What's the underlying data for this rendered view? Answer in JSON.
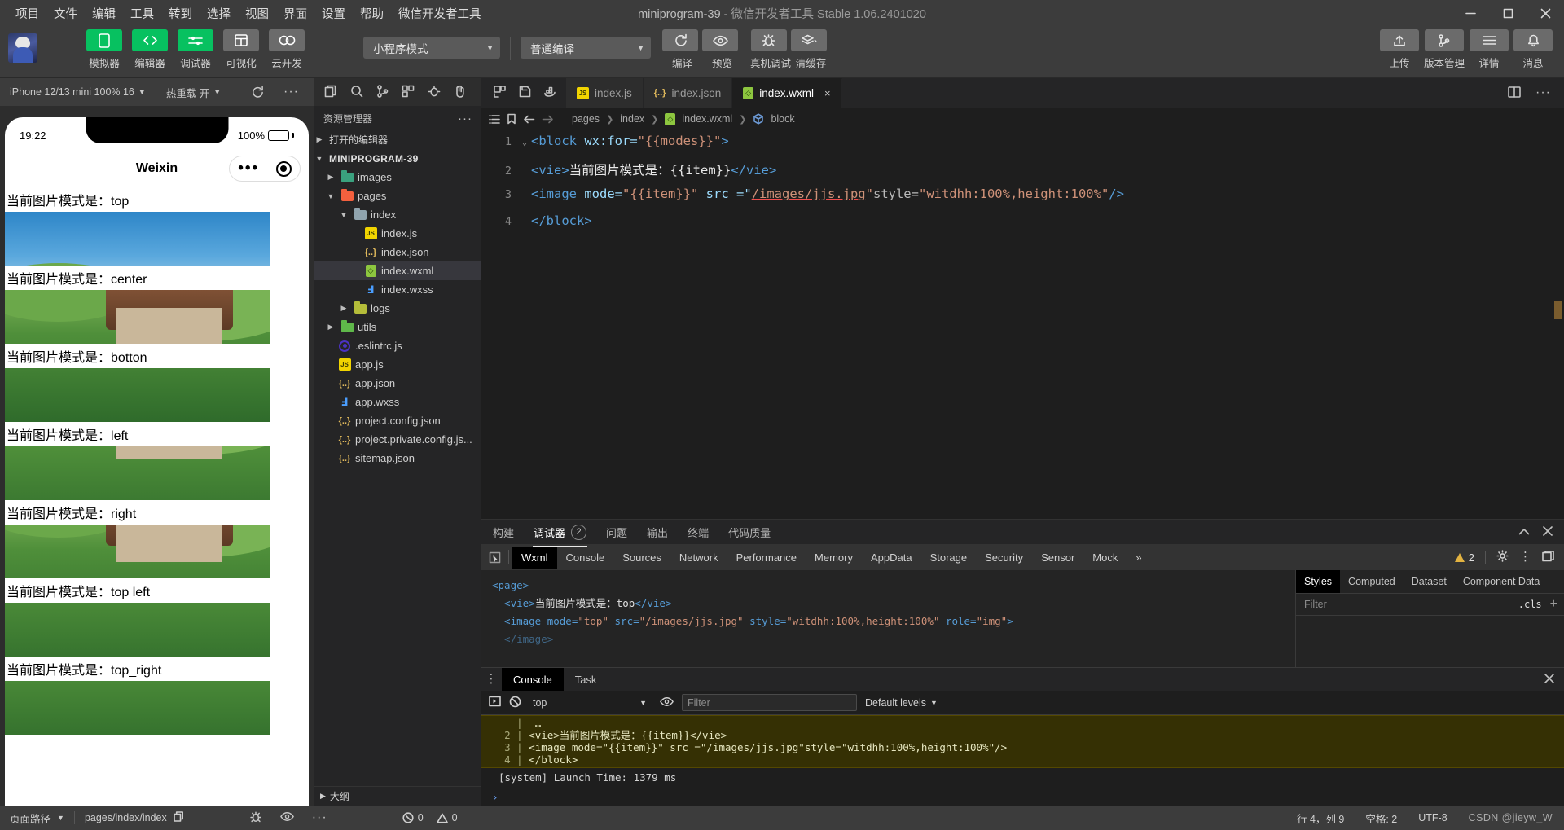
{
  "menubar": {
    "items": [
      "项目",
      "文件",
      "编辑",
      "工具",
      "转到",
      "选择",
      "视图",
      "界面",
      "设置",
      "帮助",
      "微信开发者工具"
    ],
    "title_main": "miniprogram-39",
    "title_dim": "- 微信开发者工具 Stable 1.06.2401020",
    "window_controls": [
      "minimize-icon",
      "maximize-icon",
      "close-icon"
    ]
  },
  "toolbar": {
    "modes": [
      {
        "label": "模拟器",
        "icon": "phone-icon",
        "active": true
      },
      {
        "label": "编辑器",
        "icon": "code-icon",
        "active": true
      },
      {
        "label": "调试器",
        "icon": "sliders-icon",
        "active": true
      },
      {
        "label": "可视化",
        "icon": "layout-icon",
        "active": false
      },
      {
        "label": "云开发",
        "icon": "cloud-icon",
        "active": false
      }
    ],
    "mode_select": "小程序模式",
    "compile_select": "普通编译",
    "actions": [
      {
        "label": "编译",
        "icon": "refresh-icon"
      },
      {
        "label": "预览",
        "icon": "eye-icon"
      },
      {
        "label": "真机调试",
        "icon": "bug-icon"
      },
      {
        "label": "清缓存",
        "icon": "layers-icon"
      }
    ],
    "right_actions": [
      {
        "label": "上传",
        "icon": "upload-icon"
      },
      {
        "label": "版本管理",
        "icon": "branch-icon"
      },
      {
        "label": "详情",
        "icon": "menu-icon"
      },
      {
        "label": "消息",
        "icon": "bell-icon"
      }
    ]
  },
  "simulator": {
    "device": "iPhone 12/13 mini 100% 16",
    "hot_reload": "热重载 开",
    "refresh_icon": "refresh-icon",
    "more_icon": "ellipsis-icon",
    "status_time": "19:22",
    "battery_pct": "100%",
    "nav_title": "Weixin",
    "items": [
      {
        "label": "当前图片模式是：",
        "value": "top"
      },
      {
        "label": "当前图片模式是：",
        "value": "center"
      },
      {
        "label": "当前图片模式是：",
        "value": "botton"
      },
      {
        "label": "当前图片模式是：",
        "value": "left"
      },
      {
        "label": "当前图片模式是：",
        "value": "right"
      },
      {
        "label": "当前图片模式是：",
        "value": "top left"
      },
      {
        "label": "当前图片模式是：",
        "value": "top_right"
      }
    ]
  },
  "explorer": {
    "icons": [
      "new-file-icon",
      "search-icon",
      "source-control-icon",
      "extensions-icon",
      "debug-icon",
      "hand-icon"
    ],
    "title": "资源管理器",
    "more_icon": "ellipsis-icon",
    "open_editors": "打开的编辑器",
    "project_root": "MINIPROGRAM-39",
    "tree": [
      {
        "label": "images",
        "type": "folder",
        "depth": 1,
        "expanded": false
      },
      {
        "label": "pages",
        "type": "folder-red",
        "depth": 1,
        "expanded": true
      },
      {
        "label": "index",
        "type": "folder-plain",
        "depth": 2,
        "expanded": true
      },
      {
        "label": "index.js",
        "type": "js",
        "depth": 3
      },
      {
        "label": "index.json",
        "type": "json",
        "depth": 3
      },
      {
        "label": "index.wxml",
        "type": "wxml",
        "depth": 3,
        "selected": true
      },
      {
        "label": "index.wxss",
        "type": "wxss",
        "depth": 3
      },
      {
        "label": "logs",
        "type": "folder-olive",
        "depth": 1,
        "expanded": false
      },
      {
        "label": "utils",
        "type": "folder-green",
        "depth": 1,
        "expanded": false
      },
      {
        "label": ".eslintrc.js",
        "type": "eslint",
        "depth": 1
      },
      {
        "label": "app.js",
        "type": "js",
        "depth": 1
      },
      {
        "label": "app.json",
        "type": "json",
        "depth": 1
      },
      {
        "label": "app.wxss",
        "type": "wxss",
        "depth": 1
      },
      {
        "label": "project.config.json",
        "type": "json",
        "depth": 1
      },
      {
        "label": "project.private.config.js...",
        "type": "json",
        "depth": 1
      },
      {
        "label": "sitemap.json",
        "type": "json",
        "depth": 1
      }
    ],
    "outline": "大纲"
  },
  "editor": {
    "tab_actions": [
      "split-icon",
      "save-icon",
      "docker-icon"
    ],
    "tabs": [
      {
        "label": "index.js",
        "icon": "js",
        "active": false
      },
      {
        "label": "index.json",
        "icon": "json",
        "active": false
      },
      {
        "label": "index.wxml",
        "icon": "wxml",
        "active": true,
        "close": "×"
      }
    ],
    "tabs_right": [
      "split-editor-icon",
      "ellipsis-icon"
    ],
    "breadcrumb_icons": [
      "outline-icon",
      "bookmark-icon",
      "back-icon",
      "forward-icon"
    ],
    "breadcrumb": [
      "pages",
      "index",
      "index.wxml",
      "block"
    ],
    "lines": [
      {
        "n": "1",
        "fold": "⌄"
      },
      {
        "n": "2",
        "fold": ""
      },
      {
        "n": "3",
        "fold": ""
      },
      {
        "n": "4",
        "fold": ""
      }
    ],
    "code": {
      "l1_a": "<block",
      "l1_b": " wx:for=",
      "l1_c": "\"{{modes}}\"",
      "l1_d": ">",
      "l2_a": "<vie>",
      "l2_b": "当前图片模式是：{{item}}",
      "l2_c": "</vie>",
      "l3_a": "<image",
      "l3_b": " mode=",
      "l3_c": "\"{{item}}\"",
      "l3_d": " src =\"",
      "l3_e": "/images/jjs.jpg",
      "l3_f": "\"",
      "l3_g": "style=",
      "l3_h": "\"witdhh:100%,height:100%\"",
      "l3_i": "/>",
      "l4_a": "</block>"
    }
  },
  "debugger": {
    "tabs": [
      {
        "label": "构建",
        "active": false
      },
      {
        "label": "调试器",
        "active": true,
        "count": "2"
      },
      {
        "label": "问题",
        "active": false
      },
      {
        "label": "输出",
        "active": false
      },
      {
        "label": "终端",
        "active": false
      },
      {
        "label": "代码质量",
        "active": false
      }
    ],
    "collapse_icon": "chevron-up-icon",
    "close_icon": "close-icon",
    "devtools_tabs": [
      "Wxml",
      "Console",
      "Sources",
      "Network",
      "Performance",
      "Memory",
      "AppData",
      "Storage",
      "Security",
      "Sensor",
      "Mock"
    ],
    "devtools_active": "Wxml",
    "overflow": "»",
    "warning_count": "2",
    "right_icons": [
      "gear-icon",
      "kebab-icon",
      "dock-icon"
    ],
    "picker_icon": "inspect-icon",
    "wxml_tree": {
      "l1": "<page>",
      "l2_a": "  <vie>",
      "l2_b": "当前图片模式是：top",
      "l2_c": "</vie>",
      "l3_a": "  <image mode=",
      "l3_b": "\"top\"",
      "l3_c": " src=",
      "l3_d": "\"/images/jjs.jpg\"",
      "l3_e": " style=",
      "l3_f": "\"witdhh:100%,height:100%\"",
      "l3_g": " role=",
      "l3_h": "\"img\"",
      "l3_i": ">",
      "l4": "  </image>"
    },
    "styles_tabs": [
      "Styles",
      "Computed",
      "Dataset",
      "Component Data"
    ],
    "styles_active": "Styles",
    "styles_filter_placeholder": "Filter",
    "styles_cls": ".cls",
    "styles_plus": "+"
  },
  "console": {
    "tabs": [
      "Console",
      "Task"
    ],
    "active_tab": "Console",
    "kebab_icon": "kebab-icon",
    "close_icon": "close-icon",
    "run_icon": "play-icon",
    "clear_icon": "clear-icon",
    "eye_icon": "eye-icon",
    "context": "top",
    "filter_placeholder": "Filter",
    "levels": "Default levels",
    "warning_lines": [
      {
        "n": "1",
        "text": "…"
      },
      {
        "n": "2",
        "text": "<vie>当前图片模式是：{{item}}</vie>"
      },
      {
        "n": "3",
        "text": "<image mode=\"{{item}}\" src =\"/images/jjs.jpg\"style=\"witdhh:100%,height:100%\"/>"
      },
      {
        "n": "4",
        "text": "</block>"
      }
    ],
    "system_line": "[system] Launch Time: 1379 ms",
    "prompt": "›"
  },
  "statusbar": {
    "page_path_label": "页面路径",
    "page_path": "pages/index/index",
    "copy_icon": "copy-icon",
    "icons": [
      "bug-icon",
      "eye-icon",
      "ellipsis-icon"
    ],
    "errors": "0",
    "warnings": "0",
    "cursor": "行 4，列 9",
    "spaces": "空格: 2",
    "encoding": "UTF-8",
    "watermark": "CSDN @jieyw_W"
  }
}
